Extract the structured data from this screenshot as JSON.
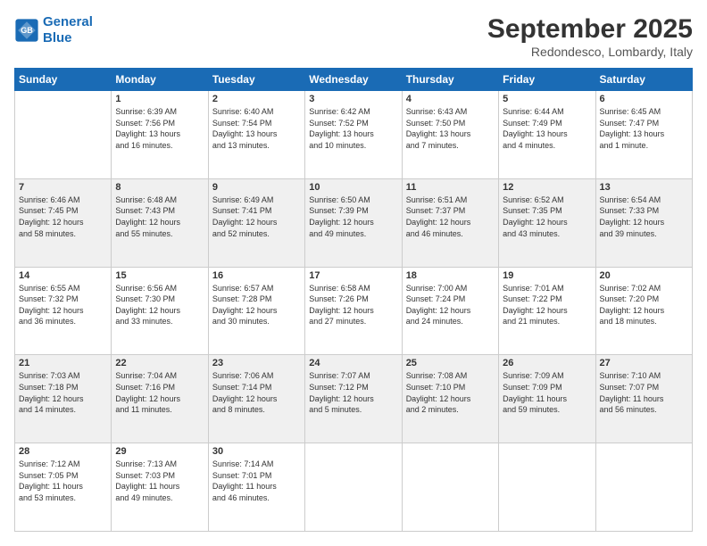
{
  "header": {
    "logo_line1": "General",
    "logo_line2": "Blue",
    "title": "September 2025",
    "location": "Redondesco, Lombardy, Italy"
  },
  "days_of_week": [
    "Sunday",
    "Monday",
    "Tuesday",
    "Wednesday",
    "Thursday",
    "Friday",
    "Saturday"
  ],
  "weeks": [
    [
      {
        "day": "",
        "info": ""
      },
      {
        "day": "1",
        "info": "Sunrise: 6:39 AM\nSunset: 7:56 PM\nDaylight: 13 hours\nand 16 minutes."
      },
      {
        "day": "2",
        "info": "Sunrise: 6:40 AM\nSunset: 7:54 PM\nDaylight: 13 hours\nand 13 minutes."
      },
      {
        "day": "3",
        "info": "Sunrise: 6:42 AM\nSunset: 7:52 PM\nDaylight: 13 hours\nand 10 minutes."
      },
      {
        "day": "4",
        "info": "Sunrise: 6:43 AM\nSunset: 7:50 PM\nDaylight: 13 hours\nand 7 minutes."
      },
      {
        "day": "5",
        "info": "Sunrise: 6:44 AM\nSunset: 7:49 PM\nDaylight: 13 hours\nand 4 minutes."
      },
      {
        "day": "6",
        "info": "Sunrise: 6:45 AM\nSunset: 7:47 PM\nDaylight: 13 hours\nand 1 minute."
      }
    ],
    [
      {
        "day": "7",
        "info": "Sunrise: 6:46 AM\nSunset: 7:45 PM\nDaylight: 12 hours\nand 58 minutes."
      },
      {
        "day": "8",
        "info": "Sunrise: 6:48 AM\nSunset: 7:43 PM\nDaylight: 12 hours\nand 55 minutes."
      },
      {
        "day": "9",
        "info": "Sunrise: 6:49 AM\nSunset: 7:41 PM\nDaylight: 12 hours\nand 52 minutes."
      },
      {
        "day": "10",
        "info": "Sunrise: 6:50 AM\nSunset: 7:39 PM\nDaylight: 12 hours\nand 49 minutes."
      },
      {
        "day": "11",
        "info": "Sunrise: 6:51 AM\nSunset: 7:37 PM\nDaylight: 12 hours\nand 46 minutes."
      },
      {
        "day": "12",
        "info": "Sunrise: 6:52 AM\nSunset: 7:35 PM\nDaylight: 12 hours\nand 43 minutes."
      },
      {
        "day": "13",
        "info": "Sunrise: 6:54 AM\nSunset: 7:33 PM\nDaylight: 12 hours\nand 39 minutes."
      }
    ],
    [
      {
        "day": "14",
        "info": "Sunrise: 6:55 AM\nSunset: 7:32 PM\nDaylight: 12 hours\nand 36 minutes."
      },
      {
        "day": "15",
        "info": "Sunrise: 6:56 AM\nSunset: 7:30 PM\nDaylight: 12 hours\nand 33 minutes."
      },
      {
        "day": "16",
        "info": "Sunrise: 6:57 AM\nSunset: 7:28 PM\nDaylight: 12 hours\nand 30 minutes."
      },
      {
        "day": "17",
        "info": "Sunrise: 6:58 AM\nSunset: 7:26 PM\nDaylight: 12 hours\nand 27 minutes."
      },
      {
        "day": "18",
        "info": "Sunrise: 7:00 AM\nSunset: 7:24 PM\nDaylight: 12 hours\nand 24 minutes."
      },
      {
        "day": "19",
        "info": "Sunrise: 7:01 AM\nSunset: 7:22 PM\nDaylight: 12 hours\nand 21 minutes."
      },
      {
        "day": "20",
        "info": "Sunrise: 7:02 AM\nSunset: 7:20 PM\nDaylight: 12 hours\nand 18 minutes."
      }
    ],
    [
      {
        "day": "21",
        "info": "Sunrise: 7:03 AM\nSunset: 7:18 PM\nDaylight: 12 hours\nand 14 minutes."
      },
      {
        "day": "22",
        "info": "Sunrise: 7:04 AM\nSunset: 7:16 PM\nDaylight: 12 hours\nand 11 minutes."
      },
      {
        "day": "23",
        "info": "Sunrise: 7:06 AM\nSunset: 7:14 PM\nDaylight: 12 hours\nand 8 minutes."
      },
      {
        "day": "24",
        "info": "Sunrise: 7:07 AM\nSunset: 7:12 PM\nDaylight: 12 hours\nand 5 minutes."
      },
      {
        "day": "25",
        "info": "Sunrise: 7:08 AM\nSunset: 7:10 PM\nDaylight: 12 hours\nand 2 minutes."
      },
      {
        "day": "26",
        "info": "Sunrise: 7:09 AM\nSunset: 7:09 PM\nDaylight: 11 hours\nand 59 minutes."
      },
      {
        "day": "27",
        "info": "Sunrise: 7:10 AM\nSunset: 7:07 PM\nDaylight: 11 hours\nand 56 minutes."
      }
    ],
    [
      {
        "day": "28",
        "info": "Sunrise: 7:12 AM\nSunset: 7:05 PM\nDaylight: 11 hours\nand 53 minutes."
      },
      {
        "day": "29",
        "info": "Sunrise: 7:13 AM\nSunset: 7:03 PM\nDaylight: 11 hours\nand 49 minutes."
      },
      {
        "day": "30",
        "info": "Sunrise: 7:14 AM\nSunset: 7:01 PM\nDaylight: 11 hours\nand 46 minutes."
      },
      {
        "day": "",
        "info": ""
      },
      {
        "day": "",
        "info": ""
      },
      {
        "day": "",
        "info": ""
      },
      {
        "day": "",
        "info": ""
      }
    ]
  ]
}
